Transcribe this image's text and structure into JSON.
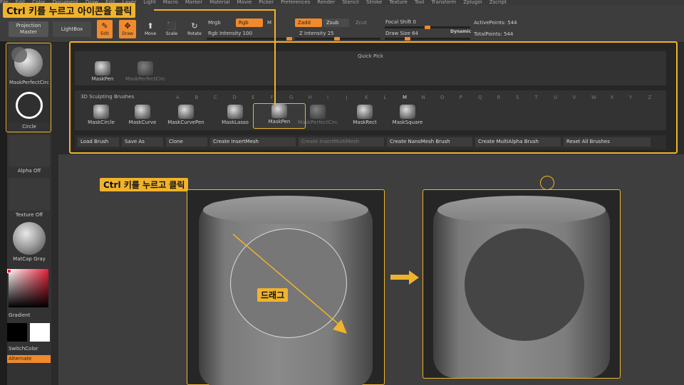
{
  "menu": [
    "File",
    "Edit",
    "Color",
    "Document",
    "Draw",
    "Edit",
    "Layer",
    "Light",
    "Macro",
    "Marker",
    "Material",
    "Movie",
    "Picker",
    "Preferences",
    "Render",
    "Stencil",
    "Stroke",
    "Texture",
    "Tool",
    "Transform",
    "Zplugin",
    "Zscript"
  ],
  "toolbar": {
    "projection_master": "Projection Master",
    "lightbox": "LightBox",
    "edit": "Edit",
    "draw": "Draw",
    "move": "Move",
    "scale": "Scale",
    "rotate": "Rotate",
    "mrgb": "Mrgb",
    "rgb": "Rgb",
    "m": "M",
    "rgb_intensity": "Rgb Intensity 100",
    "zadd": "Zadd",
    "zsub": "Zsub",
    "zcut": "Zcut",
    "z_intensity": "Z Intensity 25",
    "focal_shift": "Focal Shift 0",
    "draw_size": "Draw Size 64",
    "dynamic": "Dynamic",
    "active_points": "ActivePoints: 544",
    "total_points": "TotalPoints: 544"
  },
  "left": {
    "brush_name": "MaskPerfectCirc",
    "stroke_name": "Circle",
    "alpha": "Alpha Off",
    "texture": "Texture Off",
    "material": "MatCap Gray",
    "gradient": "Gradient",
    "switch_color": "SwitchColor",
    "alternate": "Alternate"
  },
  "popup": {
    "quick_pick_title": "Quick Pick",
    "quick_pick": [
      {
        "name": "MaskPen",
        "dim": false
      },
      {
        "name": "MaskPerfectCirc",
        "dim": true
      }
    ],
    "sculpt_title": "3D Sculpting Brushes",
    "letters": [
      "A",
      "B",
      "C",
      "D",
      "E",
      "F",
      "G",
      "H",
      "I",
      "J",
      "K",
      "L",
      "M",
      "N",
      "O",
      "P",
      "Q",
      "R",
      "S",
      "T",
      "U",
      "V",
      "W",
      "X",
      "Y",
      "Z"
    ],
    "brushes": [
      {
        "name": "MaskCircle",
        "dim": false
      },
      {
        "name": "MaskCurve",
        "dim": false
      },
      {
        "name": "MaskCurvePen",
        "dim": false
      },
      {
        "name": "MaskLasso",
        "dim": false
      },
      {
        "name": "MaskPen",
        "dim": false
      },
      {
        "name": "MaskPerfectCirc",
        "dim": true
      },
      {
        "name": "MaskRect",
        "dim": false
      },
      {
        "name": "MaskSquare",
        "dim": false
      }
    ],
    "buttons": [
      {
        "label": "Load Brush",
        "dim": false
      },
      {
        "label": "Save As",
        "dim": false
      },
      {
        "label": "Clone",
        "dim": false
      },
      {
        "label": "Create InsertMesh",
        "dim": false
      },
      {
        "label": "Create InsertMultiMesh",
        "dim": true
      },
      {
        "label": "Create NanoMesh Brush",
        "dim": false
      },
      {
        "label": "Create MultiAlpha Brush",
        "dim": false
      },
      {
        "label": "Reset All Brushes",
        "dim": false
      }
    ]
  },
  "annotations": {
    "top_tag": "Ctrl 키를 누르고 아이콘을 클릭",
    "canvas_tag": "Ctrl 키를 누르고 클릭",
    "drag_label": "드래그"
  },
  "colors": {
    "accent": "#f08a2c",
    "highlight": "#f0b32c",
    "background": "#2b2b2b"
  }
}
